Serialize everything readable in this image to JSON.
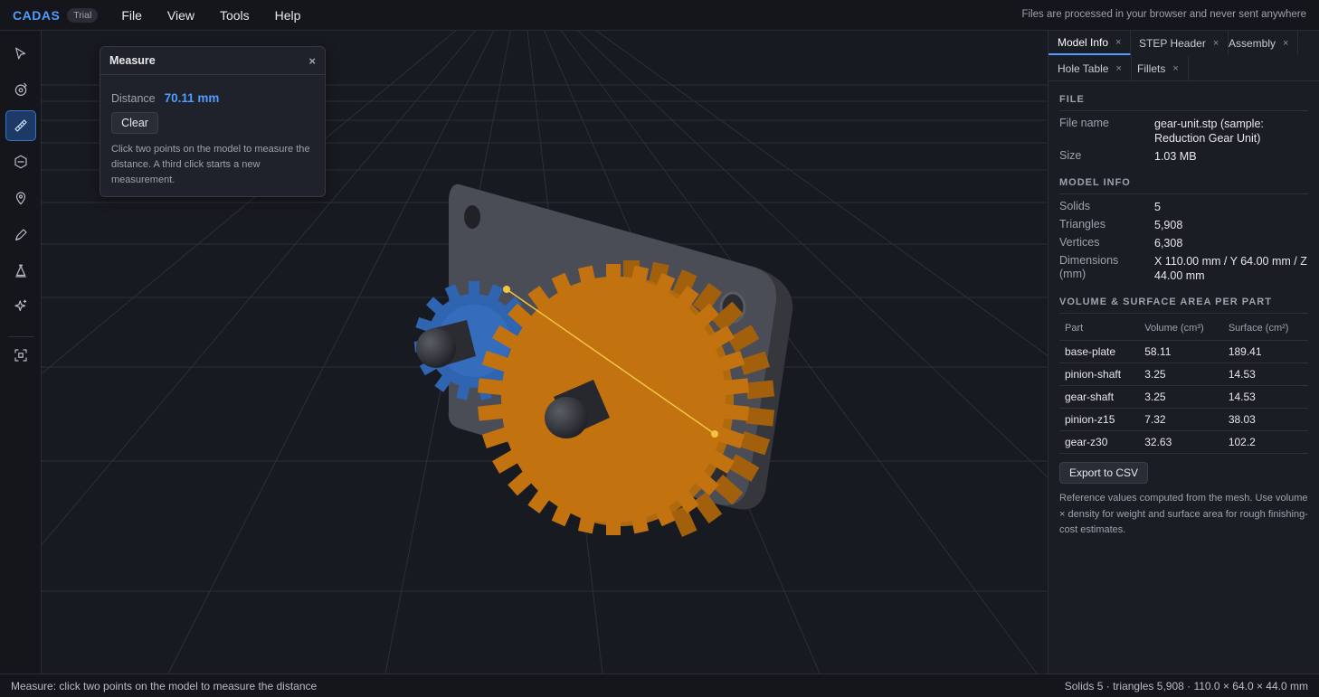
{
  "app": {
    "brand": "CADAS",
    "badge": "Trial",
    "menu": [
      "File",
      "View",
      "Tools",
      "Help"
    ],
    "privacy_note": "Files are processed in your browser and never sent anywhere"
  },
  "toolbar": {
    "tools": [
      {
        "name": "select-tool",
        "icon": "cursor-arrow-icon"
      },
      {
        "name": "orbit-tool",
        "icon": "orbit-icon"
      },
      {
        "name": "measure-tool",
        "icon": "ruler-icon",
        "active": true
      },
      {
        "name": "section-tool",
        "icon": "hexagon-icon"
      },
      {
        "name": "annotate-tool",
        "icon": "map-pin-icon"
      },
      {
        "name": "markup-tool",
        "icon": "pencil-icon"
      },
      {
        "name": "draft-analysis-tool",
        "icon": "flask-icon"
      },
      {
        "name": "ai-tool",
        "icon": "sparkle-icon"
      },
      {
        "name": "fit-view-tool",
        "icon": "frame-focus-icon"
      }
    ]
  },
  "measure": {
    "title": "Measure",
    "close": "×",
    "distance_label": "Distance",
    "distance_value": "70.11 mm",
    "clear_label": "Clear",
    "help": "Click two points on the model to measure the distance. A third click starts a new measurement."
  },
  "panel": {
    "tabs": [
      {
        "label": "Model Info",
        "active": true
      },
      {
        "label": "STEP Header"
      },
      {
        "label": "Assembly"
      },
      {
        "label": "Hole Table"
      },
      {
        "label": "Fillets"
      }
    ],
    "tab_close": "×",
    "file_section": "FILE",
    "file_name_label": "File name",
    "file_name": "gear-unit.stp (sample: Reduction Gear Unit)",
    "size_label": "Size",
    "size": "1.03 MB",
    "model_section": "MODEL INFO",
    "solids_label": "Solids",
    "solids": "5",
    "triangles_label": "Triangles",
    "triangles": "5,908",
    "vertices_label": "Vertices",
    "vertices": "6,308",
    "dimensions_label": "Dimensions (mm)",
    "dimensions": "X 110.00 mm / Y 64.00 mm / Z 44.00 mm",
    "volume_section": "VOLUME & SURFACE AREA PER PART",
    "table_headers": [
      "Part",
      "Volume (cm³)",
      "Surface (cm²)"
    ],
    "parts": [
      {
        "part": "base-plate",
        "volume": "58.11",
        "surface": "189.41"
      },
      {
        "part": "pinion-shaft",
        "volume": "3.25",
        "surface": "14.53"
      },
      {
        "part": "gear-shaft",
        "volume": "3.25",
        "surface": "14.53"
      },
      {
        "part": "pinion-z15",
        "volume": "7.32",
        "surface": "38.03"
      },
      {
        "part": "gear-z30",
        "volume": "32.63",
        "surface": "102.2"
      }
    ],
    "export_label": "Export to CSV",
    "note": "Reference values computed from the mesh. Use volume × density for weight and surface area for rough finishing-cost estimates."
  },
  "status": {
    "left": "Measure: click two points on the model to measure the distance",
    "right": "Solids 5 · triangles 5,908 · 110.0 × 64.0 × 44.0 mm"
  },
  "colors": {
    "accent": "#4f9bff",
    "gear": "#c2730f",
    "pinion": "#2f64b0",
    "plate": "#4a4d55",
    "measure_line": "#f5c542"
  }
}
